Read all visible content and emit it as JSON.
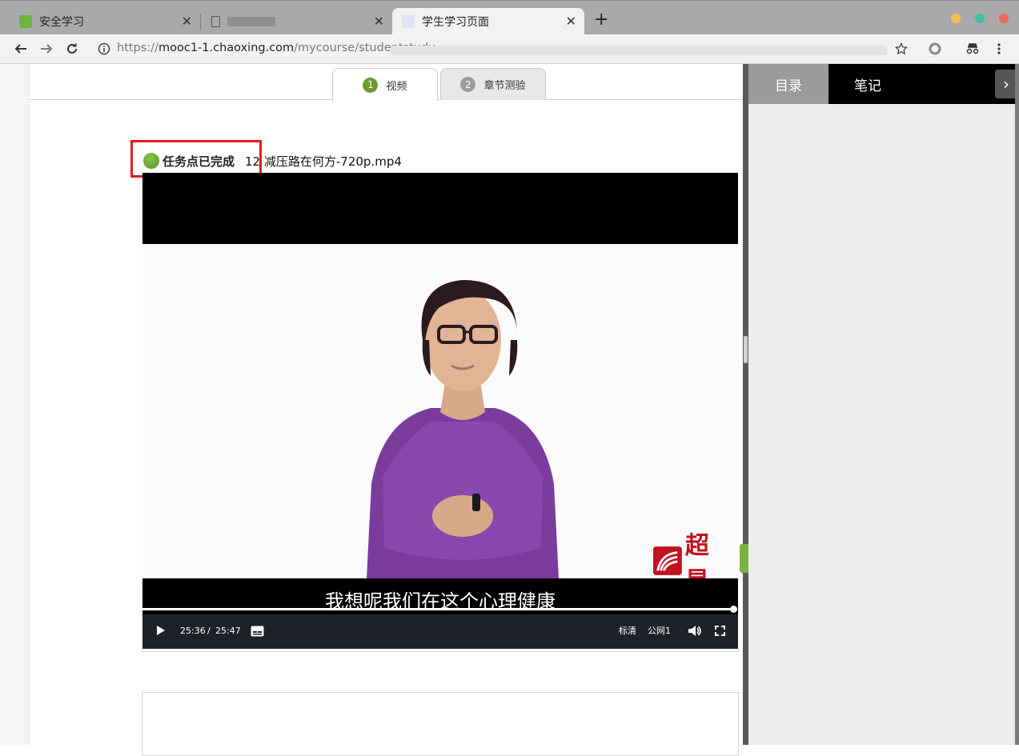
{
  "browser": {
    "tabs": [
      {
        "title": "安全学习",
        "close": "✕",
        "favicon_color": "#6cb33e"
      },
      {
        "title": "",
        "close": "✕",
        "favicon_color": "#ffffff"
      },
      {
        "title": "学生学习页面",
        "close": "✕",
        "favicon_color": "#dfe4f7"
      }
    ],
    "new_tab": "+",
    "url_prefix": "https://",
    "url_host": "mooc1-1.chaoxing.com",
    "url_path": "/mycourse/studentstudy",
    "window_dots": [
      "#f5bf4f",
      "#3dbfa0",
      "#ec6a5e"
    ],
    "icons": [
      "back-arrow-icon",
      "forward-arrow-icon",
      "reload-icon",
      "info-icon",
      "star-icon",
      "extension-icon",
      "incognito-icon",
      "menu-icon"
    ]
  },
  "content_tabs": [
    {
      "num": "1",
      "label": "视频",
      "num_color": "#6e9a33"
    },
    {
      "num": "2",
      "label": "章节测验",
      "num_color": "#9b9b9b"
    }
  ],
  "task": {
    "status": "任务点已完成",
    "file_name": "12 减压路在何方-720p.mp4"
  },
  "player": {
    "subtitle": "我想呢我们在这个心理健康",
    "current_time": "25:36",
    "time_sep": "/",
    "duration": "25:47",
    "quality": "标清",
    "line": "公网1",
    "progress_fraction": 0.993,
    "logo_text": "超星"
  },
  "sidebar": {
    "tabs": [
      "目录",
      "笔记"
    ],
    "arrow": "›"
  }
}
